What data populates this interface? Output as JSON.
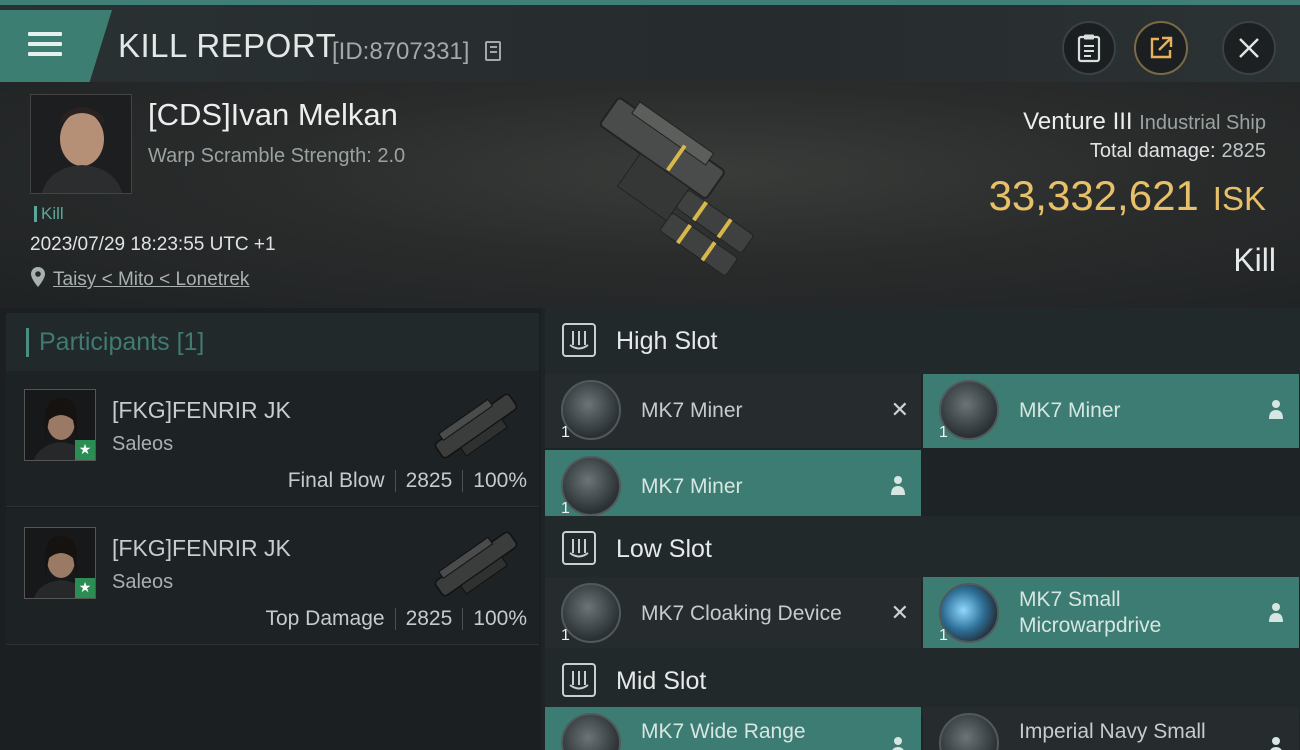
{
  "header": {
    "title": "KILL REPORT",
    "report_id": "[ID:8707331]",
    "icons": [
      "menu-icon",
      "copy-icon",
      "clipboard-icon",
      "share-icon",
      "close-icon"
    ]
  },
  "victim": {
    "name": "[CDS]Ivan Melkan",
    "subtitle": "Warp Scramble Strength: 2.0",
    "kill_tag": "Kill",
    "timestamp": "2023/07/29 18:23:55 UTC +1",
    "location": "Taisy < Mito < Lonetrek",
    "ship_name": "Venture III",
    "ship_class": "Industrial Ship",
    "total_damage_label": "Total damage:",
    "total_damage": "2825",
    "isk_value": "33,332,621",
    "isk_unit": "ISK",
    "result": "Kill"
  },
  "participants": {
    "title": "Participants",
    "count": "[1]",
    "rows": [
      {
        "name": "[FKG]FENRIR JK",
        "ship": "Saleos",
        "role": "Final Blow",
        "damage": "2825",
        "percent": "100%"
      },
      {
        "name": "[FKG]FENRIR JK",
        "ship": "Saleos",
        "role": "Top Damage",
        "damage": "2825",
        "percent": "100%"
      }
    ]
  },
  "fittings": {
    "high_slot": {
      "title": "High Slot",
      "modules": [
        {
          "name": "MK7 Miner",
          "qty": "1",
          "status": "destroyed"
        },
        {
          "name": "MK7 Miner",
          "qty": "1",
          "status": "dropped"
        },
        {
          "name": "MK7 Miner",
          "qty": "1",
          "status": "dropped"
        }
      ]
    },
    "low_slot": {
      "title": "Low Slot",
      "modules": [
        {
          "name": "MK7 Cloaking Device",
          "qty": "1",
          "status": "destroyed"
        },
        {
          "name": "MK7 Small Microwarpdrive",
          "name_line1": "MK7 Small",
          "name_line2": "Microwarpdrive",
          "qty": "1",
          "status": "dropped"
        }
      ]
    },
    "mid_slot": {
      "title": "Mid Slot",
      "modules": [
        {
          "name": "MK7 Wide Range",
          "status": "dropped"
        },
        {
          "name": "Imperial Navy Small",
          "status": "dropped"
        }
      ]
    }
  },
  "colors": {
    "accent": "#3d7c72",
    "isk": "#e8c06a",
    "participants_title": "#3f7b73"
  }
}
